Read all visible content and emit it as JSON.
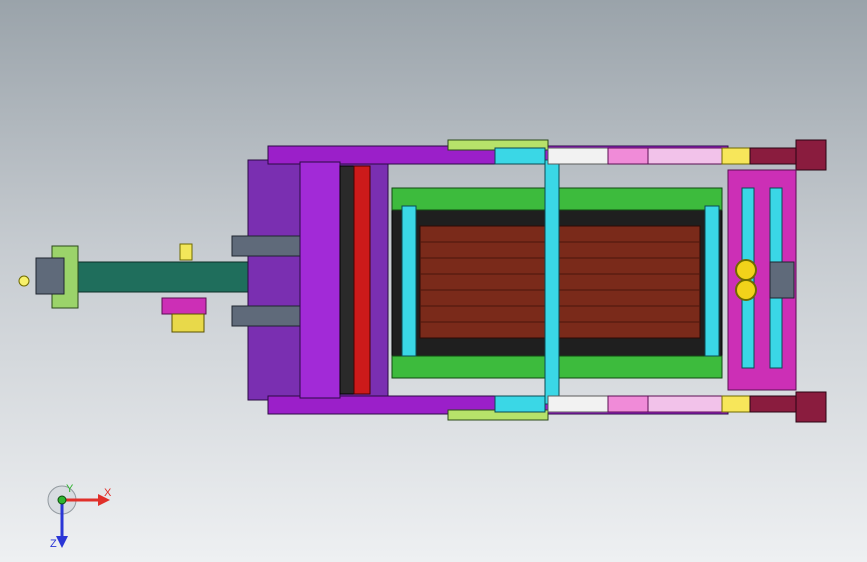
{
  "viewport": {
    "background_top": "#9aa3aa",
    "background_bottom": "#eef0f2"
  },
  "triad": {
    "x_label": "X",
    "y_label": "Y",
    "z_label": "Z",
    "x_color": "#e0302a",
    "y_color": "#2fb52f",
    "z_color": "#2a36d6"
  },
  "colors": {
    "purple": "#9b1fc9",
    "magenta": "#cc2fb6",
    "green": "#3dbb3d",
    "teal": "#1f6e5c",
    "brown": "#7a2a1a",
    "cyan": "#3ad7e6",
    "yellow": "#f2d21a",
    "pink": "#f08bd8",
    "maroon": "#8a1c3e"
  }
}
